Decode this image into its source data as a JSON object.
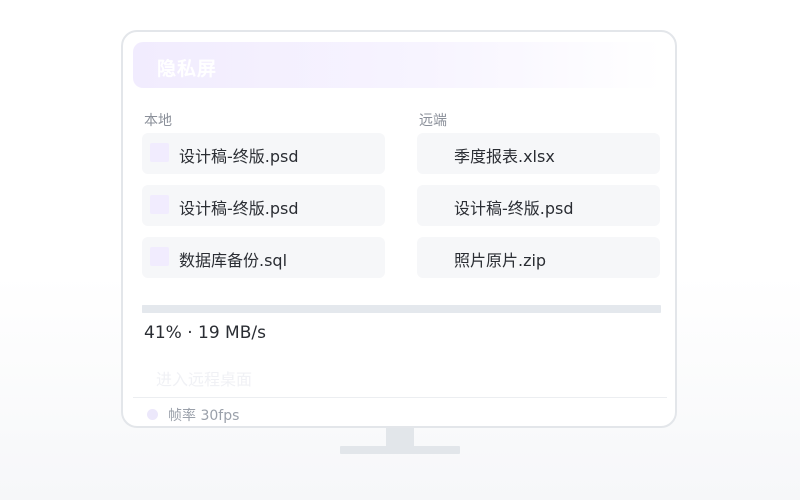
{
  "window": {
    "title": "隐私屏"
  },
  "local": {
    "label": "本地",
    "files": [
      {
        "name": "设计稿-终版.psd"
      },
      {
        "name": "设计稿-终版.psd"
      },
      {
        "name": "数据库备份.sql"
      }
    ]
  },
  "remote": {
    "label": "远端",
    "files": [
      {
        "name": "季度报表.xlsx"
      },
      {
        "name": "设计稿-终版.psd"
      },
      {
        "name": "照片原片.zip"
      }
    ]
  },
  "transfer": {
    "progress_percent": 41,
    "status_text": "41% · 19 MB/s"
  },
  "actions": {
    "enter_remote_label": "进入远程桌面"
  },
  "status": {
    "fps_label": "帧率 30fps"
  },
  "colors": {
    "accent_light": "#f1ecfe",
    "item_bg": "#f6f7f9",
    "track": "#e4e8ed",
    "text_primary": "#2a2d33",
    "text_muted": "#8a8f99"
  }
}
